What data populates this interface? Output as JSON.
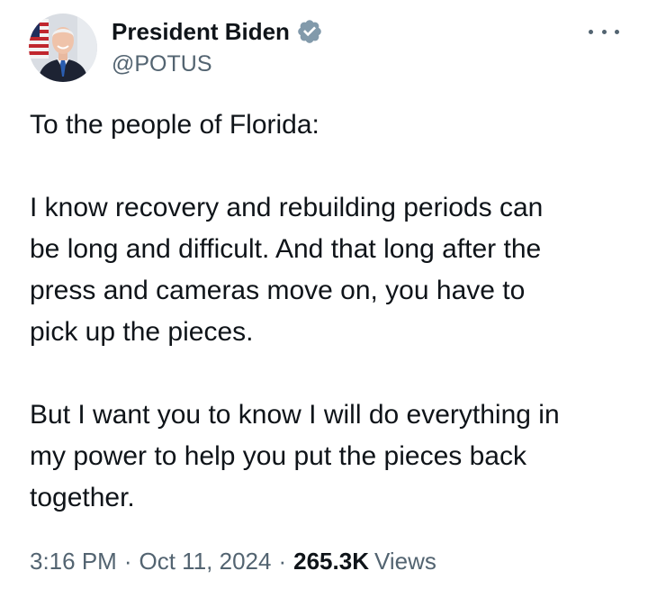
{
  "author": {
    "display_name": "President Biden",
    "handle": "@POTUS",
    "verified_icon": "verified-badge-icon",
    "verified_color": "#829aab"
  },
  "tweet": {
    "paragraphs": [
      [
        "To the people of Florida:"
      ],
      [
        "I know recovery and rebuilding periods can",
        "be long and difficult. And that long after the",
        "press and cameras move on, you have to",
        "pick up the pieces."
      ],
      [
        "But I want you to know I will do everything in",
        "my power to help you put the pieces back",
        "together."
      ]
    ]
  },
  "meta": {
    "time": "3:16 PM",
    "separator": "·",
    "date": "Oct 11, 2024",
    "views_count": "265.3K",
    "views_label": "Views"
  },
  "more_icon": "more-options-icon",
  "colors": {
    "text_primary": "#0f1419",
    "text_secondary": "#536471"
  }
}
